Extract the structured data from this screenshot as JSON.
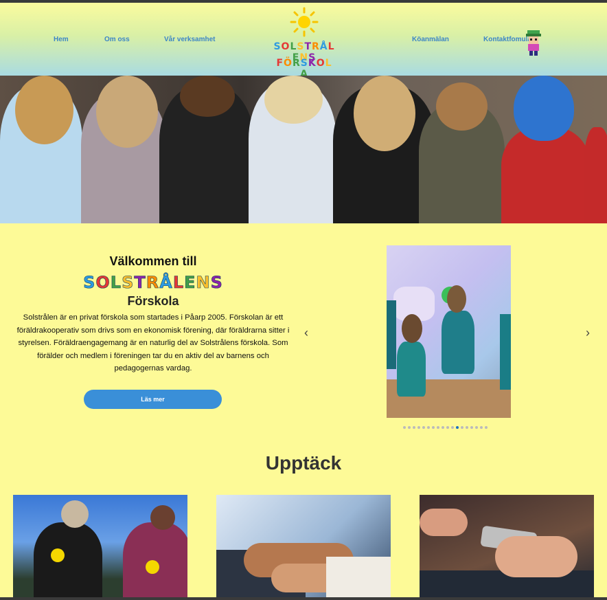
{
  "nav": {
    "left": [
      "Hem",
      "Om oss",
      "Vår verksamhet"
    ],
    "right": [
      "Köanmälan",
      "Kontaktfomulär"
    ]
  },
  "logo": {
    "line1": [
      "S",
      "O",
      "L",
      "S",
      "T",
      "R",
      "Å",
      "L",
      "E",
      "N",
      "S"
    ],
    "line2": [
      "F",
      "Ö",
      "R",
      "S",
      "K",
      "O",
      "L",
      "A"
    ],
    "icon": "sun-icon"
  },
  "welcome": {
    "heading": "Välkommen till",
    "brand": [
      "S",
      "O",
      "L",
      "S",
      "T",
      "R",
      "Å",
      "L",
      "E",
      "N",
      "S"
    ],
    "subheading": "Förskola",
    "body": "Solstrålen är en privat förskola som startades i Påarp 2005. Förskolan är ett föräldrakooperativ som drivs som en ekonomisk förening, där föräldrarna sitter i styrelsen. Föräldraengagemang är en naturlig del av Solstrålens förskola. Som förälder och medlem i föreningen tar du en aktiv del av barnens och pedagogernas vardag.",
    "button": "Läs mer"
  },
  "slider": {
    "prev": "‹",
    "next": "›",
    "dot_count": 18,
    "active_dot": 11
  },
  "discover": {
    "heading": "Upptäck"
  },
  "colors": {
    "page_bg": "#fdfa97",
    "nav_link": "#3d86c6",
    "button": "#3a8fd8",
    "letter_colors": [
      "#2f9be0",
      "#e53935",
      "#43a047",
      "#fbc02d",
      "#8e24aa",
      "#fb8c00",
      "#2f9be0",
      "#e53935",
      "#43a047",
      "#fbc02d",
      "#8e24aa"
    ]
  }
}
